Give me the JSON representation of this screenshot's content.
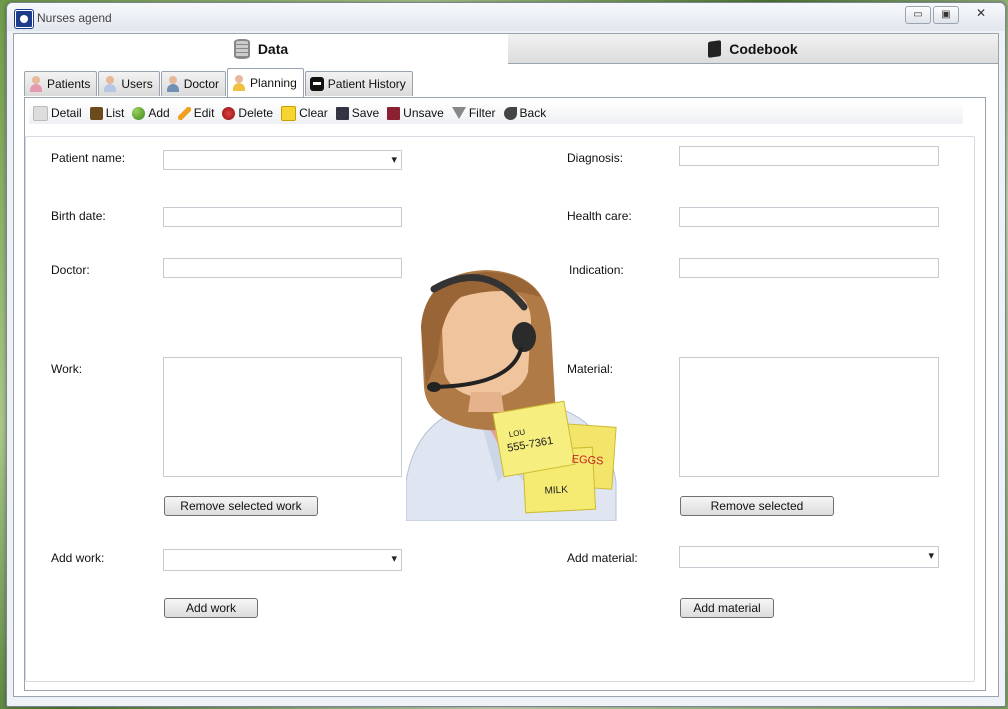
{
  "window": {
    "title": "Nurses agend",
    "controls": [
      "▭",
      "▣",
      "✕"
    ]
  },
  "top_tabs": [
    {
      "label": "Data",
      "icon": "database-icon",
      "active": true
    },
    {
      "label": "Codebook",
      "icon": "book-icon",
      "active": false
    }
  ],
  "sub_tabs": [
    {
      "label": "Patients",
      "icon": "patient-icon"
    },
    {
      "label": "Users",
      "icon": "user-icon"
    },
    {
      "label": "Doctor",
      "icon": "doctor-icon"
    },
    {
      "label": "Planning",
      "icon": "planning-icon",
      "active": true
    },
    {
      "label": "Patient History",
      "icon": "history-icon"
    }
  ],
  "toolbar": {
    "detail": "Detail",
    "list": "List",
    "add": "Add",
    "edit": "Edit",
    "delete": "Delete",
    "clear": "Clear",
    "save": "Save",
    "unsave": "Unsave",
    "filter": "Filter",
    "back": "Back"
  },
  "form": {
    "patient_name_label": "Patient name:",
    "patient_name_value": "",
    "birth_date_label": "Birth date:",
    "birth_date_value": "",
    "doctor_label": "Doctor:",
    "doctor_value": "",
    "work_label": "Work:",
    "remove_work_label": "Remove selected work",
    "add_work_label": "Add work:",
    "add_work_value": "",
    "add_work_button": "Add work",
    "diagnosis_label": "Diagnosis:",
    "diagnosis_value": "",
    "health_care_label": "Health care:",
    "health_care_value": "",
    "indication_label": "Indication:",
    "indication_value": "",
    "material_label": "Material:",
    "remove_material_label": "Remove selected",
    "add_material_label": "Add material:",
    "add_material_value": "",
    "add_material_button": "Add material"
  },
  "illustration": {
    "note_top_name": "LOU",
    "note_top_number": "555-7361",
    "note_right": "EGGS",
    "note_bottom": "MILK"
  }
}
